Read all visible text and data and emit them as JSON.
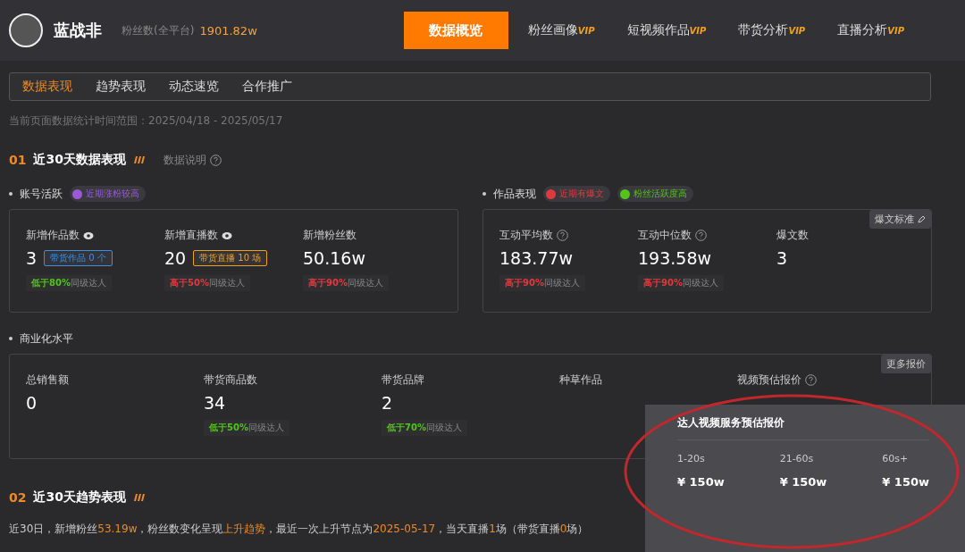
{
  "header": {
    "name": "蓝战非",
    "fans_label": "粉丝数(全平台)",
    "fans_value": "1901.82w",
    "nav": [
      {
        "label": "数据概览",
        "selected": true
      },
      {
        "label": "粉丝画像",
        "vip": "VIP",
        "selected": false
      },
      {
        "label": "短视频作品",
        "vip": "VIP",
        "selected": false
      },
      {
        "label": "带货分析",
        "vip": "VIP",
        "selected": false
      },
      {
        "label": "直播分析",
        "vip": "VIP",
        "selected": false
      }
    ]
  },
  "subtabs": [
    {
      "label": "数据表现",
      "selected": true
    },
    {
      "label": "趋势表现",
      "selected": false
    },
    {
      "label": "动态速览",
      "selected": false
    },
    {
      "label": "合作推广",
      "selected": false
    }
  ],
  "date_range": "当前页面数据统计时间范围：2025/04/18 - 2025/05/17",
  "section1": {
    "number": "01",
    "title": "近30天数据表现",
    "help": "数据说明"
  },
  "groups": [
    {
      "title": "账号活跃",
      "tags": [
        {
          "label": "近期涨粉较高",
          "color": "#9b59d6"
        }
      ],
      "metrics": [
        {
          "label": "新增作品数",
          "kind": "eye",
          "value": "3",
          "badge": {
            "label": "带货作品 0 个",
            "color": "#3a8ee6"
          },
          "compare": {
            "highlight": "低于80%",
            "rest": "同级达人",
            "color": "#52c41a"
          }
        },
        {
          "label": "新增直播数",
          "kind": "eye",
          "value": "20",
          "badge": {
            "label": "带货直播 10 场",
            "color": "#f0a020"
          },
          "compare": {
            "highlight": "高于50%",
            "rest": "同级达人",
            "color": "#e0393e"
          }
        },
        {
          "label": "新增粉丝数",
          "kind": "plain",
          "value": "50.16w",
          "compare": {
            "highlight": "高于90%",
            "rest": "同级达人",
            "color": "#e0393e"
          }
        }
      ]
    },
    {
      "title": "作品表现",
      "tags": [
        {
          "label": "近期有爆文",
          "color": "#e0393e"
        },
        {
          "label": "粉丝活跃度高",
          "color": "#52c41a"
        }
      ],
      "corner_button": "爆文标准",
      "metrics": [
        {
          "label": "互动平均数",
          "kind": "help",
          "value": "183.77w",
          "compare": {
            "highlight": "高于90%",
            "rest": "同级达人",
            "color": "#e0393e"
          }
        },
        {
          "label": "互动中位数",
          "kind": "help",
          "value": "193.58w",
          "compare": {
            "highlight": "高于90%",
            "rest": "同级达人",
            "color": "#e0393e"
          }
        },
        {
          "label": "爆文数",
          "kind": "plain",
          "value": "3"
        }
      ]
    }
  ],
  "commerce": {
    "title": "商业化水平",
    "corner_button": "更多报价",
    "metrics": [
      {
        "label": "总销售额",
        "kind": "plain",
        "value": "0"
      },
      {
        "label": "带货商品数",
        "kind": "plain",
        "value": "34",
        "compare": {
          "highlight": "低于50%",
          "rest": "同级达人",
          "color": "#52c41a"
        }
      },
      {
        "label": "带货品牌",
        "kind": "plain",
        "value": "2",
        "compare": {
          "highlight": "低于70%",
          "rest": "同级达人",
          "color": "#52c41a"
        }
      },
      {
        "label": "种草作品",
        "kind": "plain"
      },
      {
        "label": "视频预估报价",
        "kind": "help"
      }
    ]
  },
  "popup": {
    "title": "达人视频服务预估报价",
    "prices": [
      {
        "duration": "1-20s",
        "price": "¥ 150w"
      },
      {
        "duration": "21-60s",
        "price": "¥ 150w"
      },
      {
        "duration": "60s+",
        "price": "¥ 150w"
      }
    ]
  },
  "section2": {
    "number": "02",
    "title": "近30天趋势表现"
  },
  "summary": [
    {
      "text": "近30日，新增粉丝",
      "hl": false
    },
    {
      "text": "53.19w",
      "hl": true
    },
    {
      "text": "，粉丝数变化呈现",
      "hl": false
    },
    {
      "text": "上升趋势",
      "hl": true
    },
    {
      "text": "，最近一次上升节点为",
      "hl": false
    },
    {
      "text": "2025-05-17",
      "hl": true
    },
    {
      "text": "，当天直播",
      "hl": false
    },
    {
      "text": "1",
      "hl": true
    },
    {
      "text": "场（带货直播",
      "hl": false
    },
    {
      "text": "0",
      "hl": true
    },
    {
      "text": "场）",
      "hl": false
    }
  ]
}
